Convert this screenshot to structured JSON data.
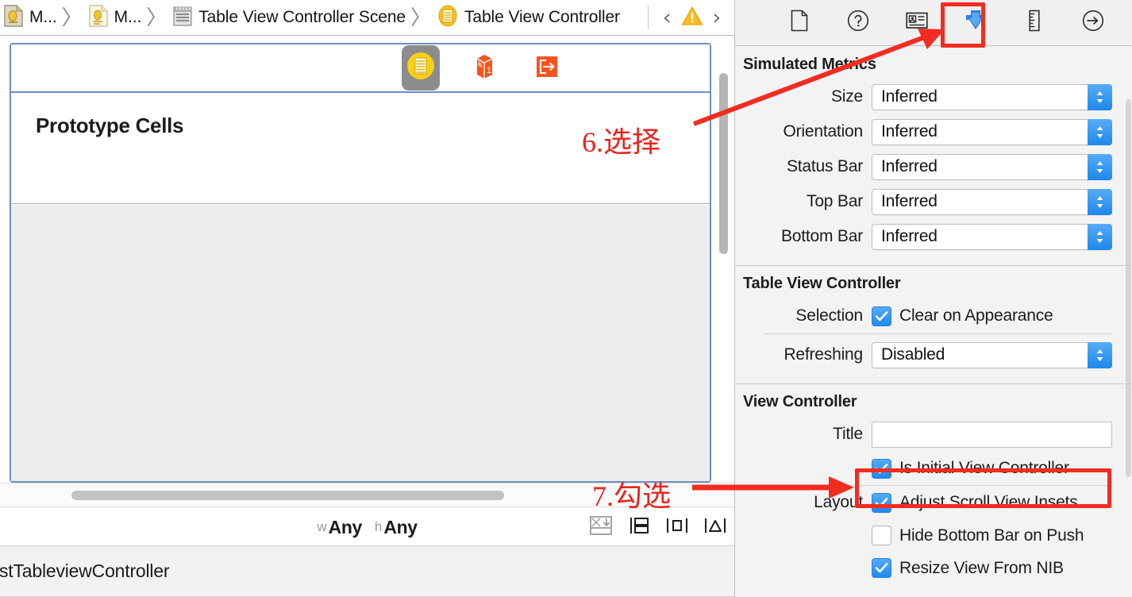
{
  "jumpbar": {
    "crumbs": [
      {
        "label": "M...",
        "icon": "storyboard-file-icon"
      },
      {
        "label": "M...",
        "icon": "storyboard-doc-icon"
      },
      {
        "label": "Table View Controller Scene",
        "icon": "scene-clapper-icon"
      },
      {
        "label": "Table View Controller",
        "icon": "table-view-controller-icon"
      }
    ],
    "separator": "〉",
    "prev_label": "‹",
    "next_label": "›",
    "warning_icon": "warning-triangle-icon"
  },
  "canvas": {
    "dock_items": [
      {
        "name": "table-view-controller-dock-icon",
        "selected": true
      },
      {
        "name": "first-responder-dock-icon",
        "selected": false
      },
      {
        "name": "exit-dock-icon",
        "selected": false
      }
    ],
    "prototype_cells_label": "Prototype Cells"
  },
  "ib_bar": {
    "size_class_w_prefix": "w",
    "size_class_w_value": "Any",
    "size_class_h_prefix": "h",
    "size_class_h_value": "Any",
    "autolayout_buttons": [
      {
        "name": "update-frames-button",
        "disabled": true
      },
      {
        "name": "embed-in-stack-button",
        "disabled": false
      },
      {
        "name": "align-button",
        "disabled": false
      },
      {
        "name": "pin-button",
        "disabled": false
      }
    ]
  },
  "status": {
    "text": "stTableviewController"
  },
  "inspector": {
    "tabs": [
      {
        "name": "file-inspector-tab",
        "icon": "document-icon",
        "selected": false
      },
      {
        "name": "quick-help-inspector-tab",
        "icon": "question-circle-icon",
        "selected": false
      },
      {
        "name": "identity-inspector-tab",
        "icon": "identity-card-icon",
        "selected": false
      },
      {
        "name": "attributes-inspector-tab",
        "icon": "attributes-shield-icon",
        "selected": true
      },
      {
        "name": "size-inspector-tab",
        "icon": "ruler-icon",
        "selected": false
      },
      {
        "name": "connections-inspector-tab",
        "icon": "arrow-circle-icon",
        "selected": false
      }
    ],
    "sections": [
      {
        "title": "Simulated Metrics",
        "rows": [
          {
            "label": "Size",
            "value": "Inferred"
          },
          {
            "label": "Orientation",
            "value": "Inferred"
          },
          {
            "label": "Status Bar",
            "value": "Inferred"
          },
          {
            "label": "Top Bar",
            "value": "Inferred"
          },
          {
            "label": "Bottom Bar",
            "value": "Inferred"
          }
        ]
      },
      {
        "title": "Table View Controller",
        "selection_label": "Selection",
        "selection_checkbox_label": "Clear on Appearance",
        "selection_checked": true,
        "refreshing_label": "Refreshing",
        "refreshing_value": "Disabled"
      },
      {
        "title": "View Controller",
        "title_label": "Title",
        "title_value": "",
        "is_initial_label": "Is Initial View Controller",
        "is_initial_checked": true,
        "layout_label": "Layout",
        "layout_options": [
          {
            "label": "Adjust Scroll View Insets",
            "checked": true
          },
          {
            "label": "Hide Bottom Bar on Push",
            "checked": false
          },
          {
            "label": "Resize View From NIB",
            "checked": true
          }
        ]
      }
    ]
  },
  "annotations": [
    {
      "id": "step6",
      "text": "6.选择"
    },
    {
      "id": "step7",
      "text": "7.勾选"
    }
  ],
  "colors": {
    "accent_blue": "#2089ec",
    "annotation_red": "#e8241f",
    "highlight_box_red": "#f22c20",
    "scene_border_blue": "#6d8fc4",
    "dock_yellow": "#f5c518",
    "dock_orange": "#f4551f"
  }
}
